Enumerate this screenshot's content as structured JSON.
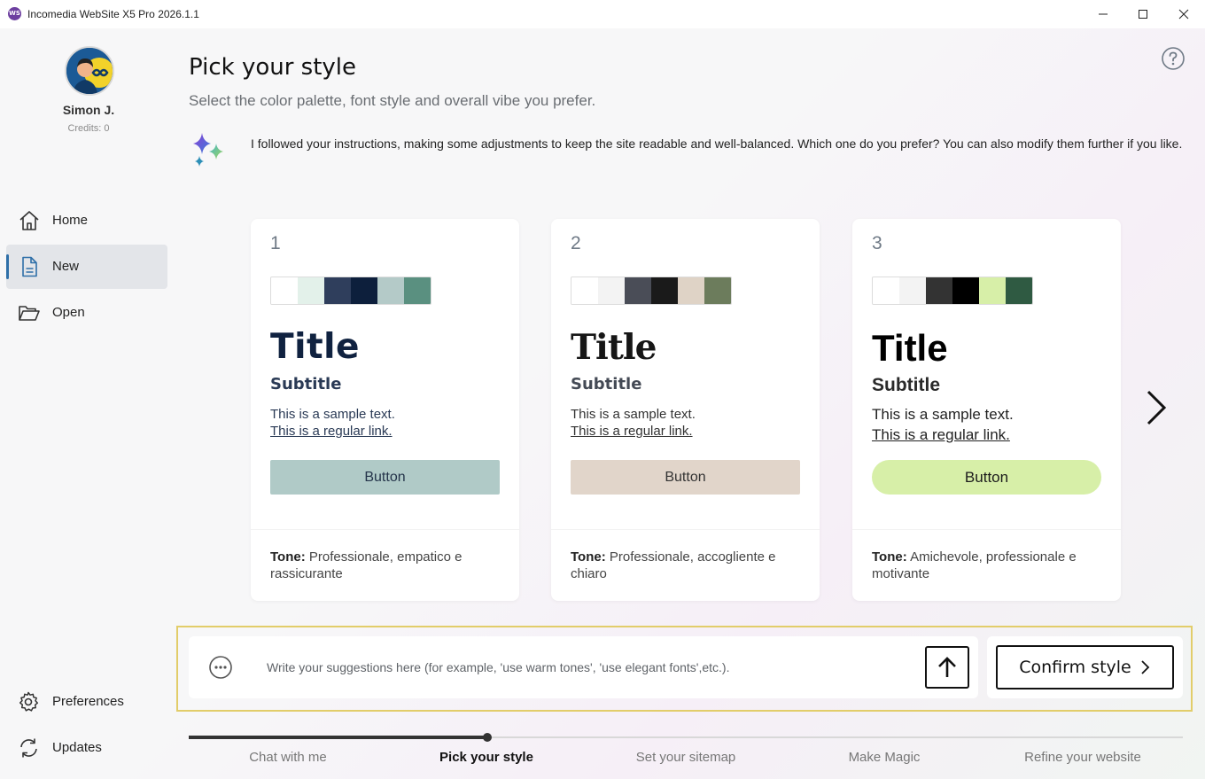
{
  "window": {
    "icon_text": "WS",
    "title": "Incomedia WebSite X5 Pro 2026.1.1"
  },
  "user": {
    "name": "Simon J.",
    "credits": "Credits: 0"
  },
  "sidebar": {
    "items": [
      {
        "label": "Home",
        "icon": "home-icon"
      },
      {
        "label": "New",
        "icon": "new-document-icon",
        "active": true
      },
      {
        "label": "Open",
        "icon": "folder-open-icon"
      }
    ],
    "bottom_items": [
      {
        "label": "Preferences",
        "icon": "gear-icon"
      },
      {
        "label": "Updates",
        "icon": "refresh-icon"
      }
    ]
  },
  "main": {
    "title": "Pick your style",
    "subtitle": "Select the color palette, font style and overall vibe you prefer.",
    "ai_message": "I followed your instructions, making some adjustments to keep the site readable and well-balanced. Which one do you prefer? You can also modify them further if you like."
  },
  "cards": [
    {
      "number": "1",
      "palette": [
        "#ffffff",
        "#e3f1ea",
        "#2f3e5c",
        "#0d1f3c",
        "#b4cac8",
        "#5a9080"
      ],
      "title": "Title",
      "subtitle": "Subtitle",
      "text": "This is a sample text.",
      "link": "This is a regular link.",
      "button": "Button",
      "tone_label": "Tone:",
      "tone": "Professionale, empatico e rassicurante"
    },
    {
      "number": "2",
      "palette": [
        "#ffffff",
        "#f3f3f3",
        "#4a4d57",
        "#1a1a1a",
        "#dfd3c6",
        "#6c7c5c"
      ],
      "title": "Title",
      "subtitle": "Subtitle",
      "text": "This is a sample text.",
      "link": "This is a regular link.",
      "button": "Button",
      "tone_label": "Tone:",
      "tone": "Professionale, accogliente e chiaro"
    },
    {
      "number": "3",
      "palette": [
        "#ffffff",
        "#f3f3f3",
        "#333333",
        "#000000",
        "#d7efa8",
        "#2f5a42"
      ],
      "title": "Title",
      "subtitle": "Subtitle",
      "text": "This is a sample text.",
      "link": "This is a regular link.",
      "button": "Button",
      "tone_label": "Tone:",
      "tone": "Amichevole, professionale e motivante"
    }
  ],
  "suggest": {
    "placeholder": "Write your suggestions here (for example, 'use warm tones', 'use elegant fonts',etc.).",
    "confirm_label": "Confirm style"
  },
  "progress": {
    "completed_fraction": 0.3,
    "steps": [
      {
        "label": "Chat with me",
        "active": false
      },
      {
        "label": "Pick your style",
        "active": true
      },
      {
        "label": "Set your sitemap",
        "active": false
      },
      {
        "label": "Make Magic",
        "active": false
      },
      {
        "label": "Refine your website",
        "active": false
      }
    ]
  },
  "colors": {
    "accent": "#2e6fa8",
    "highlight_border": "#e2cd6a"
  }
}
